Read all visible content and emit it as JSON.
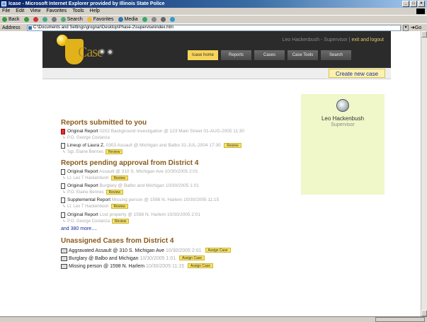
{
  "window": {
    "title": "Icase - Microsoft Internet Explorer provided by Illinois State Police",
    "buttons": [
      "_",
      "□",
      "×"
    ]
  },
  "menubar": [
    "File",
    "Edit",
    "View",
    "Favorites",
    "Tools",
    "Help"
  ],
  "toolbar": {
    "back": "Back",
    "search": "Search",
    "favorites": "Favorites",
    "media": "Media"
  },
  "address": {
    "label": "Address",
    "url": "C:\\Documents and Settings\\grognar\\Desktop\\Phase-2\\supervise\\index.htm",
    "go_label": "Go"
  },
  "app": {
    "logo_text": "Case",
    "user_line": "Leo Hackenbush - Supervisor",
    "exit_label": "exit and logout",
    "nav": [
      "Icase home",
      "Reports",
      "Cases",
      "Case Tools",
      "Search"
    ],
    "create_label": "Create new case"
  },
  "user_card": {
    "name": "Leo Hackenbush",
    "role": "Supervisor"
  },
  "sections": {
    "submitted": {
      "title": "Reports submitted to you",
      "reports": [
        {
          "type": "Original Report",
          "detail": "0202 Background investigation @ 123 Main Street 01-AUG-2005 11:30",
          "officer": "P.O. George Costanza",
          "review": "Review"
        },
        {
          "type": "Lineup of Laura Z.",
          "detail": "0303 Assault @ Michigan and Balbo 31-JUL-2004 17:30",
          "officer": "Sgt. Elaine Bennes",
          "review": "Review"
        }
      ]
    },
    "pending": {
      "title": "Reports pending approval from District 4",
      "reports": [
        {
          "type": "Original Report",
          "detail": "Assault @ 310 S. Michigan Ave 10/30/2005 2:01",
          "officer": "Lt. Leo T Hackenbush",
          "review": "Review"
        },
        {
          "type": "Original Report",
          "detail": "Burglary @ Balbo and Michigan 10/30/2005 1:01",
          "officer": "P.O. Elaine Bennes",
          "review": "Review"
        },
        {
          "type": "Supplemental Report",
          "detail": "Missing person @ 1598 N. Harlem 10/30/2005 11:15",
          "officer": "Lt. Leo T Hackenbush",
          "review": "Review"
        },
        {
          "type": "Original Report",
          "detail": "Lost property @ 1598 N. Harlem 10/30/2005 2:01",
          "officer": "P.O. George Costanza",
          "review": "Review"
        }
      ],
      "more_label": "and 380 more...."
    },
    "unassigned": {
      "title": "Unassigned Cases from District 4",
      "cases": [
        {
          "name": "Aggravated Assault @ 310 S. Michigan Ave",
          "date": "10/30/2005 2:01",
          "action": "Assign Case"
        },
        {
          "name": "Burglary @ Balbo and Michigan",
          "date": "10/30/2005 1:01",
          "action": "Assign Case"
        },
        {
          "name": "Missing person @ 1598 N. Harlem",
          "date": "10/30/2005 11:15",
          "action": "Assign Case"
        }
      ]
    }
  },
  "colors": {
    "header_bg": "#2b2b2b",
    "accent_yellow": "#f7d45a",
    "section_title": "#8a5a1a",
    "card_bg": "#f0f7c8"
  }
}
